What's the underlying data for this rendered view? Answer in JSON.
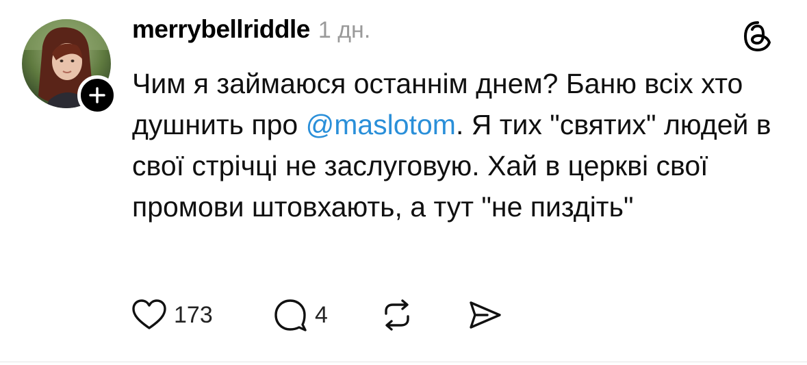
{
  "post": {
    "username": "merrybellriddle",
    "timestamp": "1 дн.",
    "text_before_mention": "Чим я займаюся останнім днем? Баню всіх хто душнить про ",
    "mention": "@maslotom",
    "text_after_mention": ". Я тих \"святих\" людей в свої стрічці не заслуговую. Хай в церкві свої промови штовхають, а тут \"не пиздіть\""
  },
  "actions": {
    "like_count": "173",
    "reply_count": "4"
  },
  "icons": {
    "logo": "threads-icon",
    "follow": "plus-icon",
    "like": "heart-icon",
    "reply": "comment-icon",
    "repost": "repost-icon",
    "share": "send-icon"
  },
  "colors": {
    "mention": "#2a8fd9",
    "text": "#101010",
    "muted": "#9a9a9a"
  }
}
